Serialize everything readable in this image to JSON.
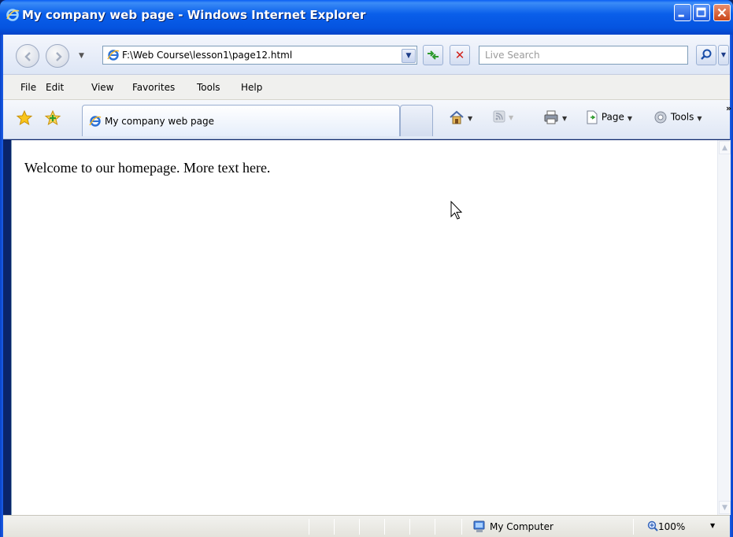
{
  "window": {
    "title": "My company web page - Windows Internet Explorer"
  },
  "address_bar": {
    "url": "F:\\Web Course\\lesson1\\page12.html"
  },
  "search": {
    "placeholder": "Live Search"
  },
  "menu": {
    "items": [
      "File",
      "Edit",
      "View",
      "Favorites",
      "Tools",
      "Help"
    ]
  },
  "tabs": [
    {
      "label": "My company web page"
    }
  ],
  "command_bar": {
    "page_label": "Page",
    "tools_label": "Tools"
  },
  "content": {
    "text": "Welcome to our homepage. More text here."
  },
  "status_bar": {
    "zone": "My Computer",
    "zoom": "100%"
  },
  "colors": {
    "titlebar_blue": "#0554e0",
    "close_red": "#c9461a"
  }
}
